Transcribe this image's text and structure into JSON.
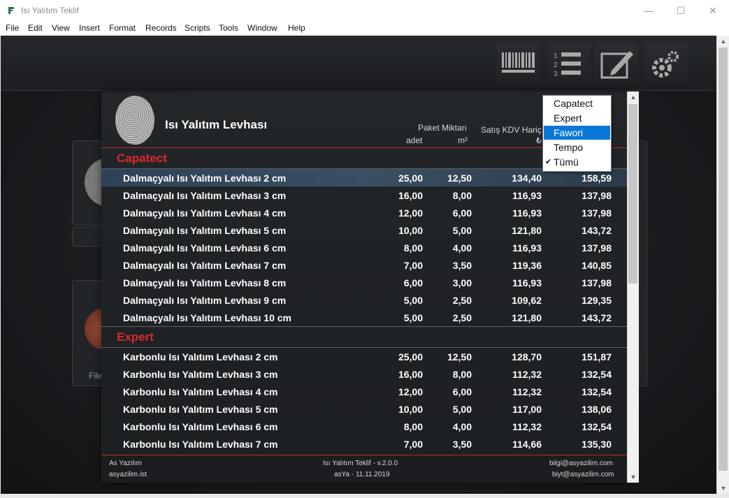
{
  "window": {
    "title": "Isı Yalıtım Teklif"
  },
  "menu": [
    "File",
    "Edit",
    "View",
    "Insert",
    "Format",
    "Records",
    "Scripts",
    "Tools",
    "Window",
    "Help"
  ],
  "toolbar": {
    "icons": [
      "barcode-icon",
      "numbered-list-icon",
      "edit-icon",
      "settings-gear-icon"
    ]
  },
  "background": {
    "label_partial": "File"
  },
  "panel": {
    "title": "Isı Yalıtım Levhası",
    "headers": {
      "paket_miktari": "Paket Miktarı",
      "adet": "adet",
      "m2": "m²",
      "satis": "Satış KDV Hariç",
      "currency": "₺"
    },
    "groups": [
      {
        "name": "Capatect",
        "rows": [
          {
            "name": "Dalmaçyalı Isı Yalıtım Levhası 2 cm",
            "adet": "25,00",
            "m2": "12,50",
            "haric": "134,40",
            "dahil": "158,59"
          },
          {
            "name": "Dalmaçyalı Isı Yalıtım Levhası 3 cm",
            "adet": "16,00",
            "m2": "8,00",
            "haric": "116,93",
            "dahil": "137,98"
          },
          {
            "name": "Dalmaçyalı Isı Yalıtım Levhası 4 cm",
            "adet": "12,00",
            "m2": "6,00",
            "haric": "116,93",
            "dahil": "137,98"
          },
          {
            "name": "Dalmaçyalı Isı Yalıtım Levhası 5 cm",
            "adet": "10,00",
            "m2": "5,00",
            "haric": "121,80",
            "dahil": "143,72"
          },
          {
            "name": "Dalmaçyalı Isı Yalıtım Levhası 6 cm",
            "adet": "8,00",
            "m2": "4,00",
            "haric": "116,93",
            "dahil": "137,98"
          },
          {
            "name": "Dalmaçyalı Isı Yalıtım Levhası 7 cm",
            "adet": "7,00",
            "m2": "3,50",
            "haric": "119,36",
            "dahil": "140,85"
          },
          {
            "name": "Dalmaçyalı Isı Yalıtım Levhası 8 cm",
            "adet": "6,00",
            "m2": "3,00",
            "haric": "116,93",
            "dahil": "137,98"
          },
          {
            "name": "Dalmaçyalı Isı Yalıtım Levhası 9 cm",
            "adet": "5,00",
            "m2": "2,50",
            "haric": "109,62",
            "dahil": "129,35"
          },
          {
            "name": "Dalmaçyalı Isı Yalıtım Levhası 10 cm",
            "adet": "5,00",
            "m2": "2,50",
            "haric": "121,80",
            "dahil": "143,72"
          }
        ]
      },
      {
        "name": "Expert",
        "rows": [
          {
            "name": "Karbonlu Isı Yalıtım Levhası 2 cm",
            "adet": "25,00",
            "m2": "12,50",
            "haric": "128,70",
            "dahil": "151,87"
          },
          {
            "name": "Karbonlu Isı Yalıtım Levhası 3 cm",
            "adet": "16,00",
            "m2": "8,00",
            "haric": "112,32",
            "dahil": "132,54"
          },
          {
            "name": "Karbonlu Isı Yalıtım Levhası 4 cm",
            "adet": "12,00",
            "m2": "6,00",
            "haric": "112,32",
            "dahil": "132,54"
          },
          {
            "name": "Karbonlu Isı Yalıtım Levhası 5 cm",
            "adet": "10,00",
            "m2": "5,00",
            "haric": "117,00",
            "dahil": "138,06"
          },
          {
            "name": "Karbonlu Isı Yalıtım Levhası 6 cm",
            "adet": "8,00",
            "m2": "4,00",
            "haric": "112,32",
            "dahil": "132,54"
          },
          {
            "name": "Karbonlu Isı Yalıtım Levhası 7 cm",
            "adet": "7,00",
            "m2": "3,50",
            "haric": "114,66",
            "dahil": "135,30"
          }
        ]
      }
    ],
    "footer": {
      "company": "As Yazılım",
      "site": "asyazilim.ist",
      "app": "Isı Yalıtım Teklif - v.2.0.0",
      "build": "asYa - 11.11.2019",
      "email1": "bilgi@asyazilim.com",
      "email2": "biyt@asyazilim.com"
    }
  },
  "dropdown": {
    "options": [
      "Capatect",
      "Expert",
      "Fawori",
      "Tempo",
      "Tümü"
    ],
    "highlighted": "Fawori",
    "checked": "Tümü"
  },
  "colors": {
    "accent_red": "#d9292b",
    "selection_blue": "#0a78d7",
    "row_highlight": "#3a4f63"
  }
}
